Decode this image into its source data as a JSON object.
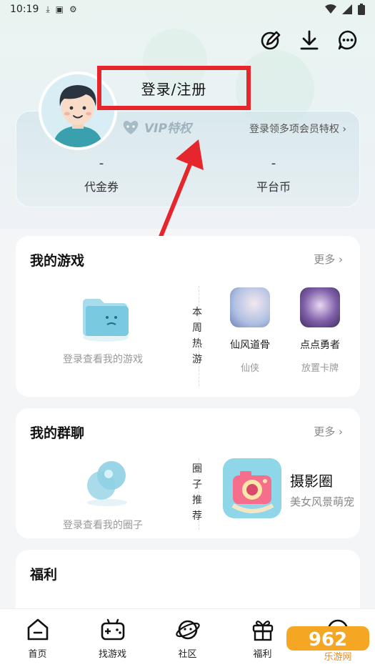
{
  "status_bar": {
    "time": "10:19"
  },
  "profile": {
    "login_label": "登录/注册",
    "vip_label": "VIP特权",
    "vip_hint": "登录领多项会员特权 ›",
    "stats": [
      {
        "value": "-",
        "label": "代金券"
      },
      {
        "value": "-",
        "label": "平台币"
      }
    ]
  },
  "my_games": {
    "title": "我的游戏",
    "more": "更多 ›",
    "empty_text": "登录查看我的游戏",
    "side_label": [
      "本",
      "周",
      "热",
      "游"
    ],
    "games": [
      {
        "name": "仙风道骨",
        "tag": "仙侠"
      },
      {
        "name": "点点勇者",
        "tag": "放置卡牌"
      }
    ]
  },
  "my_groups": {
    "title": "我的群聊",
    "more": "更多 ›",
    "empty_text": "登录查看我的圈子",
    "side_label": [
      "圈",
      "子",
      "推",
      "荐"
    ],
    "circle": {
      "name": "摄影圈",
      "desc": "美女风景萌宠"
    }
  },
  "welfare": {
    "title": "福利"
  },
  "nav": [
    {
      "label": "首页",
      "icon": "home-icon"
    },
    {
      "label": "找游戏",
      "icon": "gamepad-icon"
    },
    {
      "label": "社区",
      "icon": "planet-icon"
    },
    {
      "label": "福利",
      "icon": "gift-icon"
    },
    {
      "label": "",
      "icon": "chat-icon"
    }
  ],
  "watermark": {
    "text": "962",
    "sub": "乐游网"
  },
  "colors": {
    "highlight": "#e5262c",
    "accent": "#f5a623"
  }
}
